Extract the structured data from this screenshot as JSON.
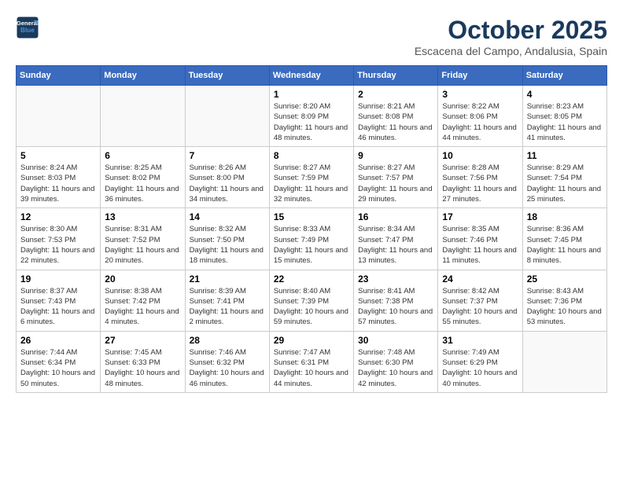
{
  "header": {
    "logo_line1": "General",
    "logo_line2": "Blue",
    "month_title": "October 2025",
    "location": "Escacena del Campo, Andalusia, Spain"
  },
  "weekdays": [
    "Sunday",
    "Monday",
    "Tuesday",
    "Wednesday",
    "Thursday",
    "Friday",
    "Saturday"
  ],
  "weeks": [
    [
      {
        "day": "",
        "info": ""
      },
      {
        "day": "",
        "info": ""
      },
      {
        "day": "",
        "info": ""
      },
      {
        "day": "1",
        "info": "Sunrise: 8:20 AM\nSunset: 8:09 PM\nDaylight: 11 hours and 48 minutes."
      },
      {
        "day": "2",
        "info": "Sunrise: 8:21 AM\nSunset: 8:08 PM\nDaylight: 11 hours and 46 minutes."
      },
      {
        "day": "3",
        "info": "Sunrise: 8:22 AM\nSunset: 8:06 PM\nDaylight: 11 hours and 44 minutes."
      },
      {
        "day": "4",
        "info": "Sunrise: 8:23 AM\nSunset: 8:05 PM\nDaylight: 11 hours and 41 minutes."
      }
    ],
    [
      {
        "day": "5",
        "info": "Sunrise: 8:24 AM\nSunset: 8:03 PM\nDaylight: 11 hours and 39 minutes."
      },
      {
        "day": "6",
        "info": "Sunrise: 8:25 AM\nSunset: 8:02 PM\nDaylight: 11 hours and 36 minutes."
      },
      {
        "day": "7",
        "info": "Sunrise: 8:26 AM\nSunset: 8:00 PM\nDaylight: 11 hours and 34 minutes."
      },
      {
        "day": "8",
        "info": "Sunrise: 8:27 AM\nSunset: 7:59 PM\nDaylight: 11 hours and 32 minutes."
      },
      {
        "day": "9",
        "info": "Sunrise: 8:27 AM\nSunset: 7:57 PM\nDaylight: 11 hours and 29 minutes."
      },
      {
        "day": "10",
        "info": "Sunrise: 8:28 AM\nSunset: 7:56 PM\nDaylight: 11 hours and 27 minutes."
      },
      {
        "day": "11",
        "info": "Sunrise: 8:29 AM\nSunset: 7:54 PM\nDaylight: 11 hours and 25 minutes."
      }
    ],
    [
      {
        "day": "12",
        "info": "Sunrise: 8:30 AM\nSunset: 7:53 PM\nDaylight: 11 hours and 22 minutes."
      },
      {
        "day": "13",
        "info": "Sunrise: 8:31 AM\nSunset: 7:52 PM\nDaylight: 11 hours and 20 minutes."
      },
      {
        "day": "14",
        "info": "Sunrise: 8:32 AM\nSunset: 7:50 PM\nDaylight: 11 hours and 18 minutes."
      },
      {
        "day": "15",
        "info": "Sunrise: 8:33 AM\nSunset: 7:49 PM\nDaylight: 11 hours and 15 minutes."
      },
      {
        "day": "16",
        "info": "Sunrise: 8:34 AM\nSunset: 7:47 PM\nDaylight: 11 hours and 13 minutes."
      },
      {
        "day": "17",
        "info": "Sunrise: 8:35 AM\nSunset: 7:46 PM\nDaylight: 11 hours and 11 minutes."
      },
      {
        "day": "18",
        "info": "Sunrise: 8:36 AM\nSunset: 7:45 PM\nDaylight: 11 hours and 8 minutes."
      }
    ],
    [
      {
        "day": "19",
        "info": "Sunrise: 8:37 AM\nSunset: 7:43 PM\nDaylight: 11 hours and 6 minutes."
      },
      {
        "day": "20",
        "info": "Sunrise: 8:38 AM\nSunset: 7:42 PM\nDaylight: 11 hours and 4 minutes."
      },
      {
        "day": "21",
        "info": "Sunrise: 8:39 AM\nSunset: 7:41 PM\nDaylight: 11 hours and 2 minutes."
      },
      {
        "day": "22",
        "info": "Sunrise: 8:40 AM\nSunset: 7:39 PM\nDaylight: 10 hours and 59 minutes."
      },
      {
        "day": "23",
        "info": "Sunrise: 8:41 AM\nSunset: 7:38 PM\nDaylight: 10 hours and 57 minutes."
      },
      {
        "day": "24",
        "info": "Sunrise: 8:42 AM\nSunset: 7:37 PM\nDaylight: 10 hours and 55 minutes."
      },
      {
        "day": "25",
        "info": "Sunrise: 8:43 AM\nSunset: 7:36 PM\nDaylight: 10 hours and 53 minutes."
      }
    ],
    [
      {
        "day": "26",
        "info": "Sunrise: 7:44 AM\nSunset: 6:34 PM\nDaylight: 10 hours and 50 minutes."
      },
      {
        "day": "27",
        "info": "Sunrise: 7:45 AM\nSunset: 6:33 PM\nDaylight: 10 hours and 48 minutes."
      },
      {
        "day": "28",
        "info": "Sunrise: 7:46 AM\nSunset: 6:32 PM\nDaylight: 10 hours and 46 minutes."
      },
      {
        "day": "29",
        "info": "Sunrise: 7:47 AM\nSunset: 6:31 PM\nDaylight: 10 hours and 44 minutes."
      },
      {
        "day": "30",
        "info": "Sunrise: 7:48 AM\nSunset: 6:30 PM\nDaylight: 10 hours and 42 minutes."
      },
      {
        "day": "31",
        "info": "Sunrise: 7:49 AM\nSunset: 6:29 PM\nDaylight: 10 hours and 40 minutes."
      },
      {
        "day": "",
        "info": ""
      }
    ]
  ]
}
